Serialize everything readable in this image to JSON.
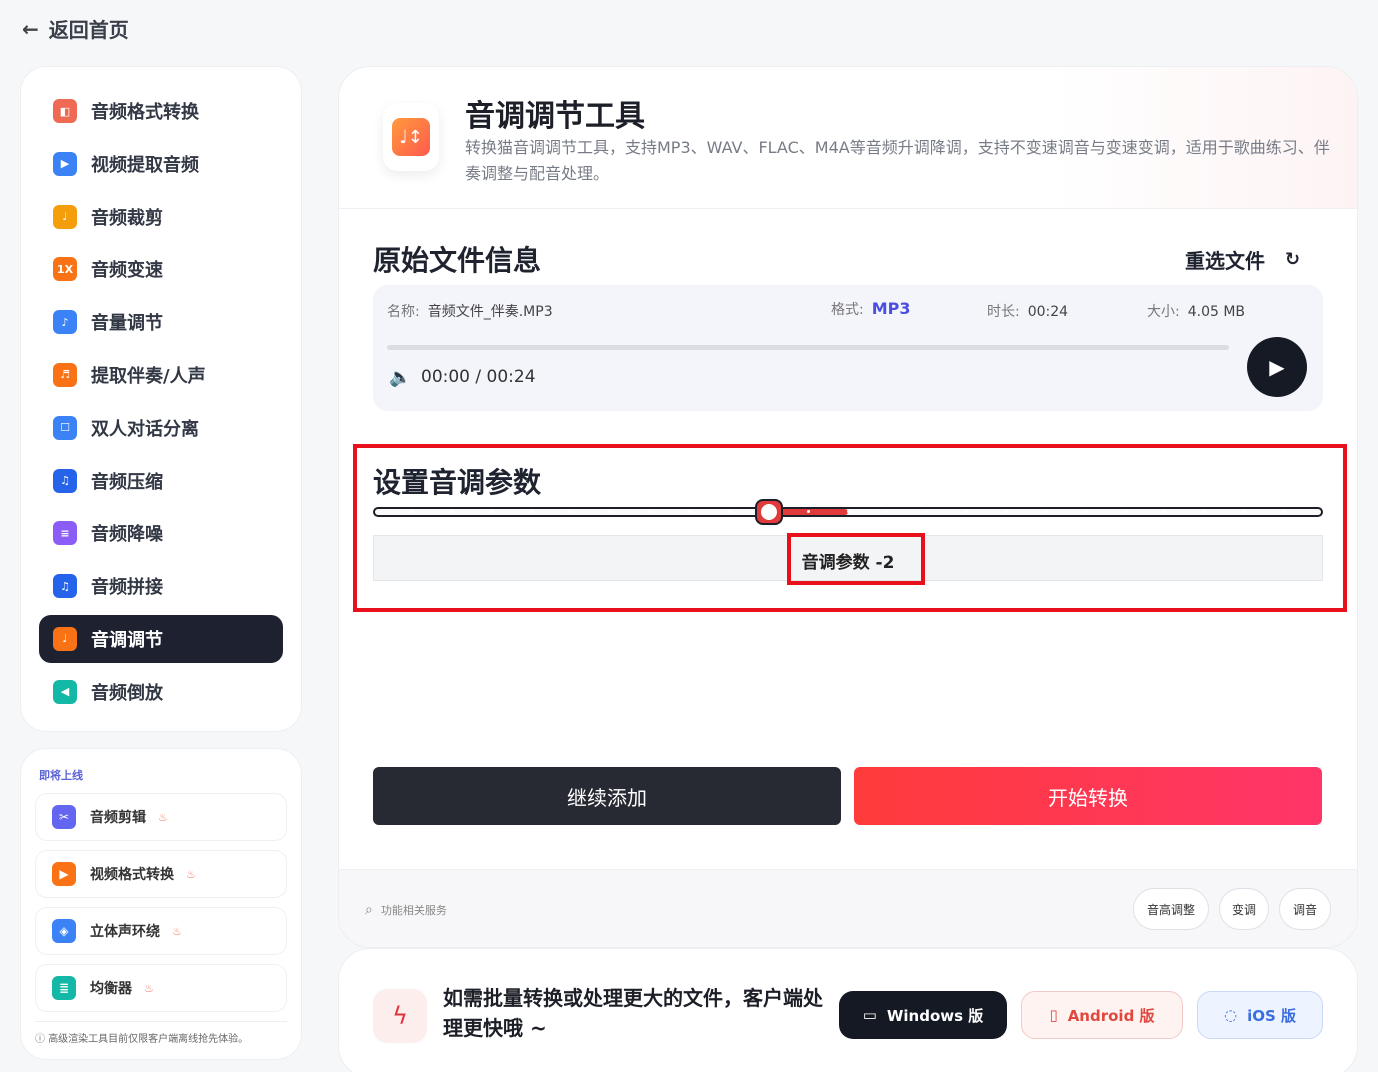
{
  "back": {
    "label": "返回首页"
  },
  "sidebar": {
    "items": [
      {
        "label": "音频格式转换",
        "color": "#ef6a55",
        "glyph": "◧"
      },
      {
        "label": "视频提取音频",
        "color": "#3b82f6",
        "glyph": "▶"
      },
      {
        "label": "音频裁剪",
        "color": "#f59e0b",
        "glyph": "♩"
      },
      {
        "label": "音频变速",
        "color": "#f97316",
        "glyph": "1X"
      },
      {
        "label": "音量调节",
        "color": "#3b82f6",
        "glyph": "♪"
      },
      {
        "label": "提取伴奏/人声",
        "color": "#f97316",
        "glyph": "♬"
      },
      {
        "label": "双人对话分离",
        "color": "#3b82f6",
        "glyph": "☐"
      },
      {
        "label": "音频压缩",
        "color": "#2563eb",
        "glyph": "♫"
      },
      {
        "label": "音频降噪",
        "color": "#8b5cf6",
        "glyph": "≡"
      },
      {
        "label": "音频拼接",
        "color": "#2563eb",
        "glyph": "♫"
      },
      {
        "label": "音调调节",
        "color": "#f97316",
        "glyph": "♩"
      },
      {
        "label": "音频倒放",
        "color": "#14b8a6",
        "glyph": "◀"
      }
    ],
    "active_index": 10
  },
  "soon": {
    "title": "即将上线",
    "items": [
      {
        "label": "音频剪辑",
        "color": "#6366f1",
        "glyph": "✂"
      },
      {
        "label": "视频格式转换",
        "color": "#f97316",
        "glyph": "▶"
      },
      {
        "label": "立体声环绕",
        "color": "#3b82f6",
        "glyph": "◈"
      },
      {
        "label": "均衡器",
        "color": "#14b8a6",
        "glyph": "≣"
      }
    ],
    "note": "高级渲染工具目前仅限客户端离线抢先体验。"
  },
  "tool": {
    "title": "音调调节工具",
    "description": "转换猫音调调节工具，支持MP3、WAV、FLAC、M4A等音频升调降调，支持不变速调音与变速变调，适用于歌曲练习、伴奏调整与配音处理。"
  },
  "file_info": {
    "section_title": "原始文件信息",
    "reselect_label": "重选文件",
    "name_key": "名称:",
    "name_value": "音频文件_伴奏.MP3",
    "format_key": "格式:",
    "format_value": "MP3",
    "duration_key": "时长:",
    "duration_value": "00:24",
    "size_key": "大小:",
    "size_value": "4.05 MB",
    "time_display": "00:00 / 00:24",
    "progress": 0
  },
  "pitch": {
    "section_title": "设置音调参数",
    "min": -12,
    "max": 12,
    "value": -2,
    "label": "音调参数 -2"
  },
  "actions": {
    "continue_label": "继续添加",
    "start_label": "开始转换"
  },
  "related": {
    "label": "功能相关服务",
    "tags": [
      "音高调整",
      "变调",
      "调音"
    ]
  },
  "promo": {
    "text": "如需批量转换或处理更大的文件，客户端处理更快哦 ~",
    "windows_label": "Windows 版",
    "android_label": "Android 版",
    "ios_label": "iOS 版"
  },
  "colors": {
    "accent_red": "#e03a3a",
    "highlight_outline": "#e8101a",
    "format_accent": "#4a4fe0"
  }
}
